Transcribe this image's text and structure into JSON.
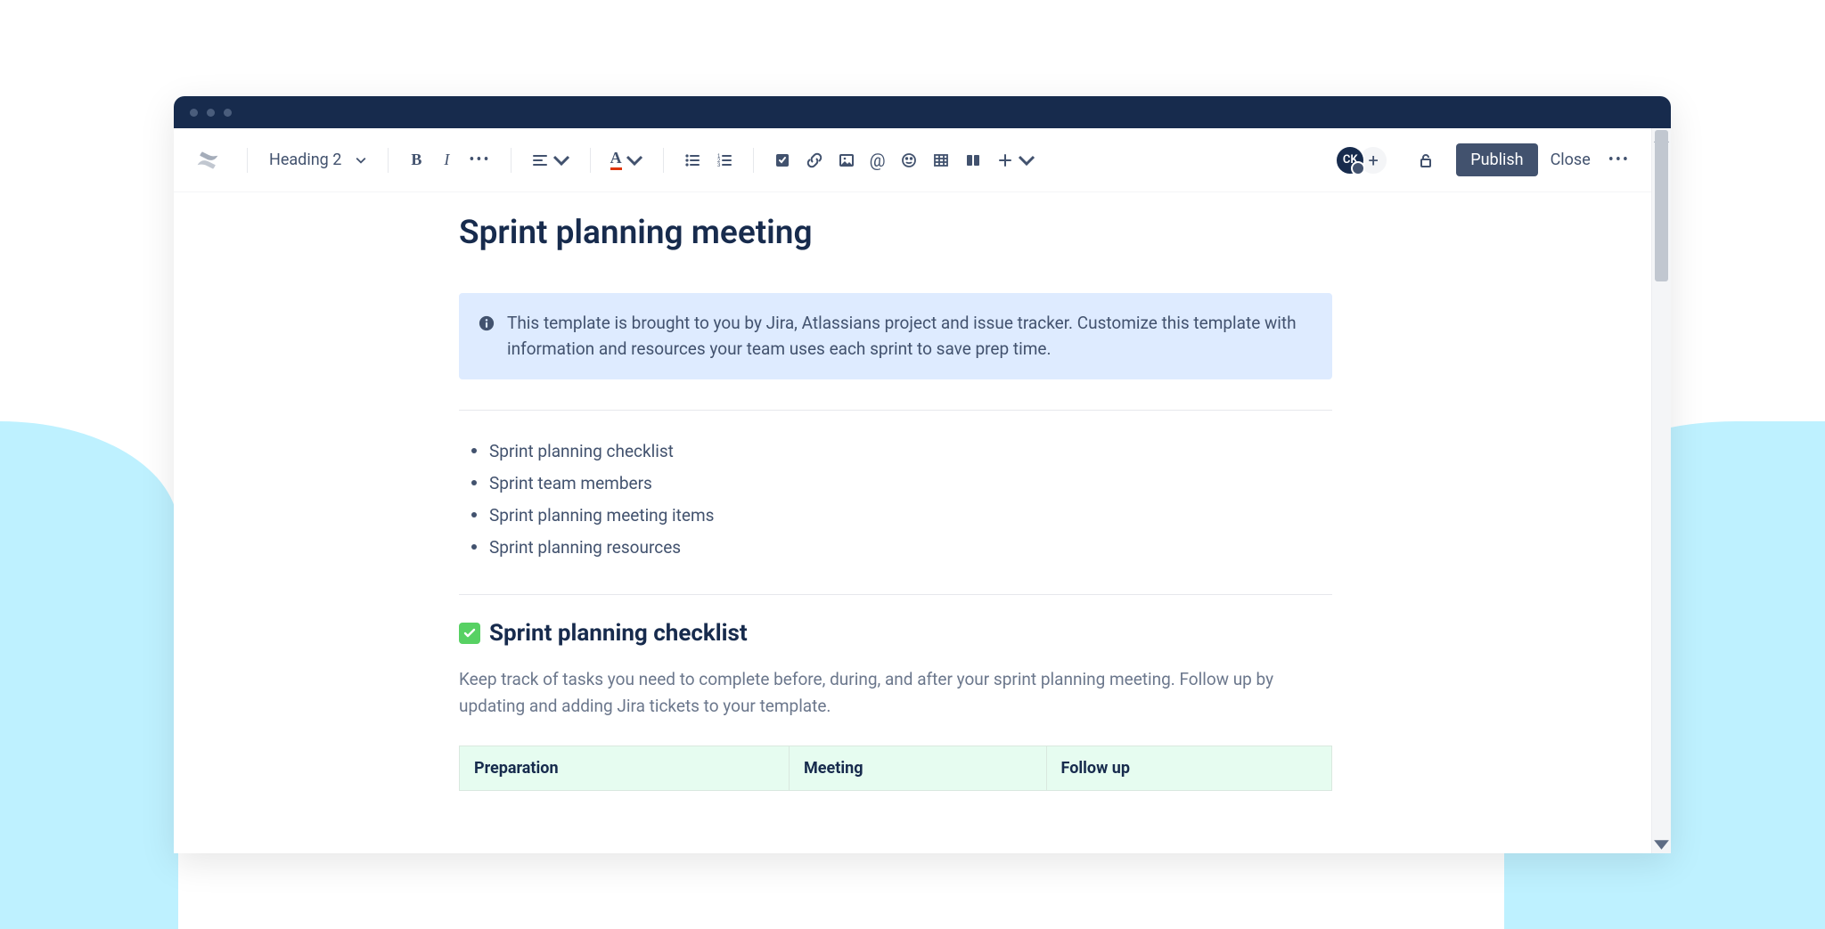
{
  "toolbar": {
    "heading_label": "Heading 2",
    "publish_label": "Publish",
    "close_label": "Close",
    "avatar_initials": "CK"
  },
  "page": {
    "title": "Sprint planning meeting",
    "info_text": "This template is brought to you by Jira, Atlassians project and issue tracker. Customize this template with information and resources your team uses each sprint to save prep time.",
    "toc": [
      "Sprint planning checklist",
      "Sprint team members",
      "Sprint planning meeting items",
      "Sprint planning resources"
    ],
    "section1": {
      "heading": "Sprint planning checklist",
      "description": "Keep track of tasks you need to complete before, during, and after your sprint planning meeting. Follow up by updating and adding Jira tickets to your template."
    },
    "table": {
      "headers": [
        "Preparation",
        "Meeting",
        "Follow up"
      ]
    }
  }
}
